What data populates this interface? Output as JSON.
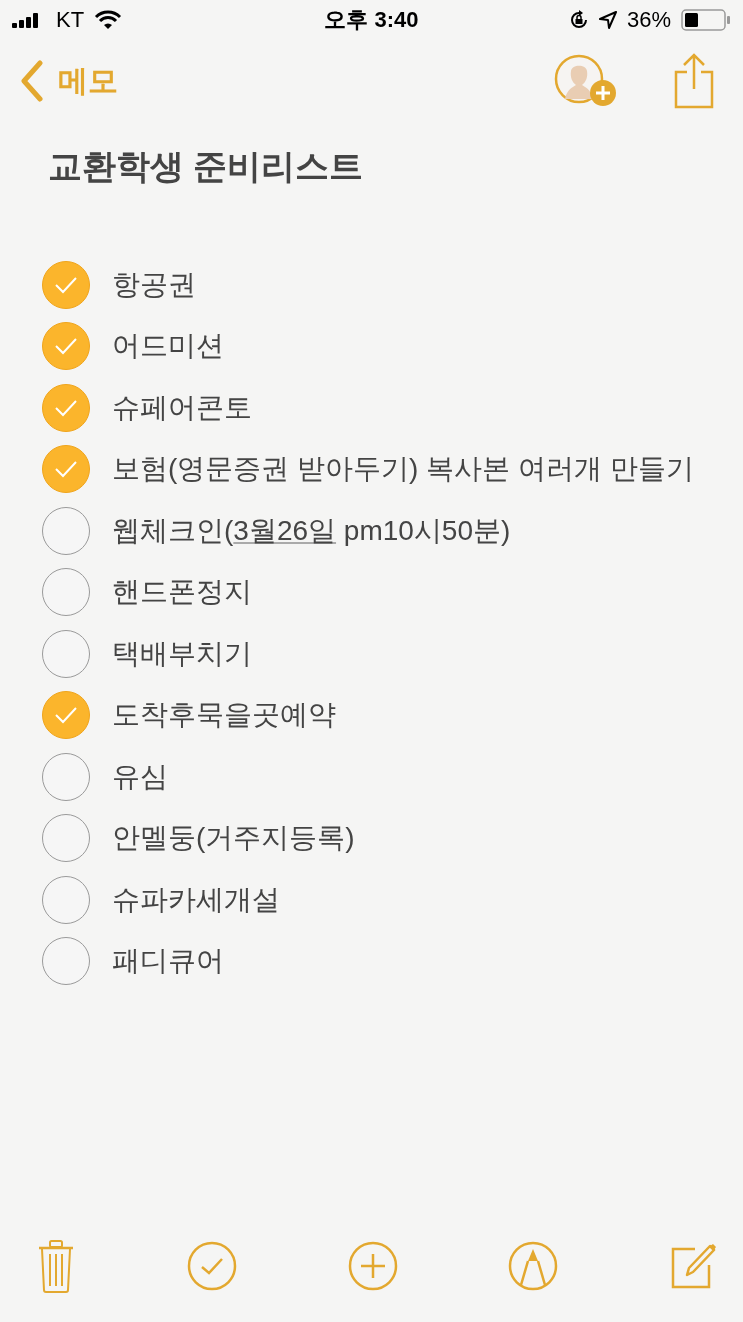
{
  "status_bar": {
    "carrier": "KT",
    "time": "오후 3:40",
    "battery": "36%"
  },
  "nav": {
    "back_label": "메모"
  },
  "note": {
    "title": "교환학생 준비리스트",
    "items": [
      {
        "parts": [
          {
            "text": "항공권",
            "link": false
          }
        ],
        "checked": true
      },
      {
        "parts": [
          {
            "text": "어드미션",
            "link": false
          }
        ],
        "checked": true
      },
      {
        "parts": [
          {
            "text": "슈페어콘토",
            "link": false
          }
        ],
        "checked": true
      },
      {
        "parts": [
          {
            "text": "보험(영문증권 받아두기) 복사본 여러개 만들기",
            "link": false
          }
        ],
        "checked": true
      },
      {
        "parts": [
          {
            "text": "웹체크인(",
            "link": false
          },
          {
            "text": "3월26일",
            "link": true
          },
          {
            "text": " pm10시50분)",
            "link": false
          }
        ],
        "checked": false
      },
      {
        "parts": [
          {
            "text": "핸드폰정지",
            "link": false
          }
        ],
        "checked": false
      },
      {
        "parts": [
          {
            "text": "택배부치기",
            "link": false
          }
        ],
        "checked": false
      },
      {
        "parts": [
          {
            "text": "도착후묵을곳예약",
            "link": false
          }
        ],
        "checked": true
      },
      {
        "parts": [
          {
            "text": "유심",
            "link": false
          }
        ],
        "checked": false
      },
      {
        "parts": [
          {
            "text": "안멜둥(거주지등록)",
            "link": false
          }
        ],
        "checked": false
      },
      {
        "parts": [
          {
            "text": "슈파카세개설",
            "link": false
          }
        ],
        "checked": false
      },
      {
        "parts": [
          {
            "text": "패디큐어",
            "link": false
          }
        ],
        "checked": false
      }
    ]
  },
  "toolbar": [
    {
      "kind": "trash"
    },
    {
      "kind": "checklist"
    },
    {
      "kind": "add"
    },
    {
      "kind": "sketch"
    },
    {
      "kind": "compose"
    }
  ]
}
